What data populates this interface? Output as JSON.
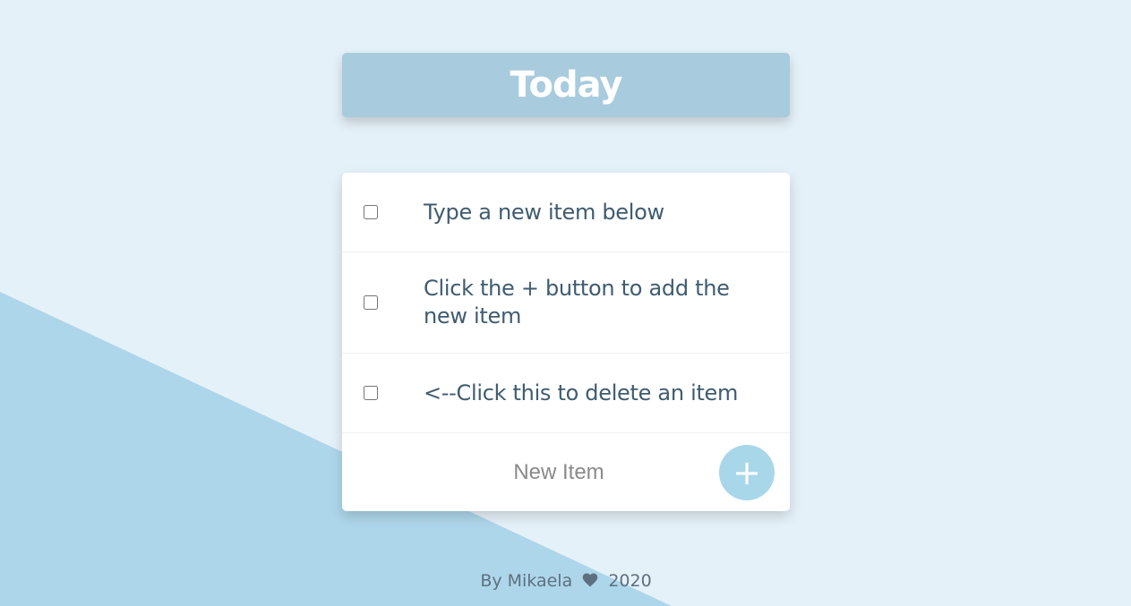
{
  "header": {
    "title": "Today"
  },
  "todo": {
    "items": [
      {
        "text": "Type a new item below",
        "checked": false
      },
      {
        "text": "Click the + button to add the new item",
        "checked": false
      },
      {
        "text": "<--Click this to delete an item",
        "checked": false
      }
    ],
    "new_item": {
      "placeholder": "New Item",
      "value": ""
    },
    "add_button_label": "+"
  },
  "footer": {
    "author_text": "By Mikaela",
    "year": "2020",
    "heart_icon": "heart-icon"
  },
  "colors": {
    "background": "#e5f1f8",
    "background_shape": "#aed6ea",
    "header_box": "#a8cbde",
    "item_text": "#3f5c70",
    "add_button": "#a8d7ea",
    "footer_text": "#5d7080"
  }
}
